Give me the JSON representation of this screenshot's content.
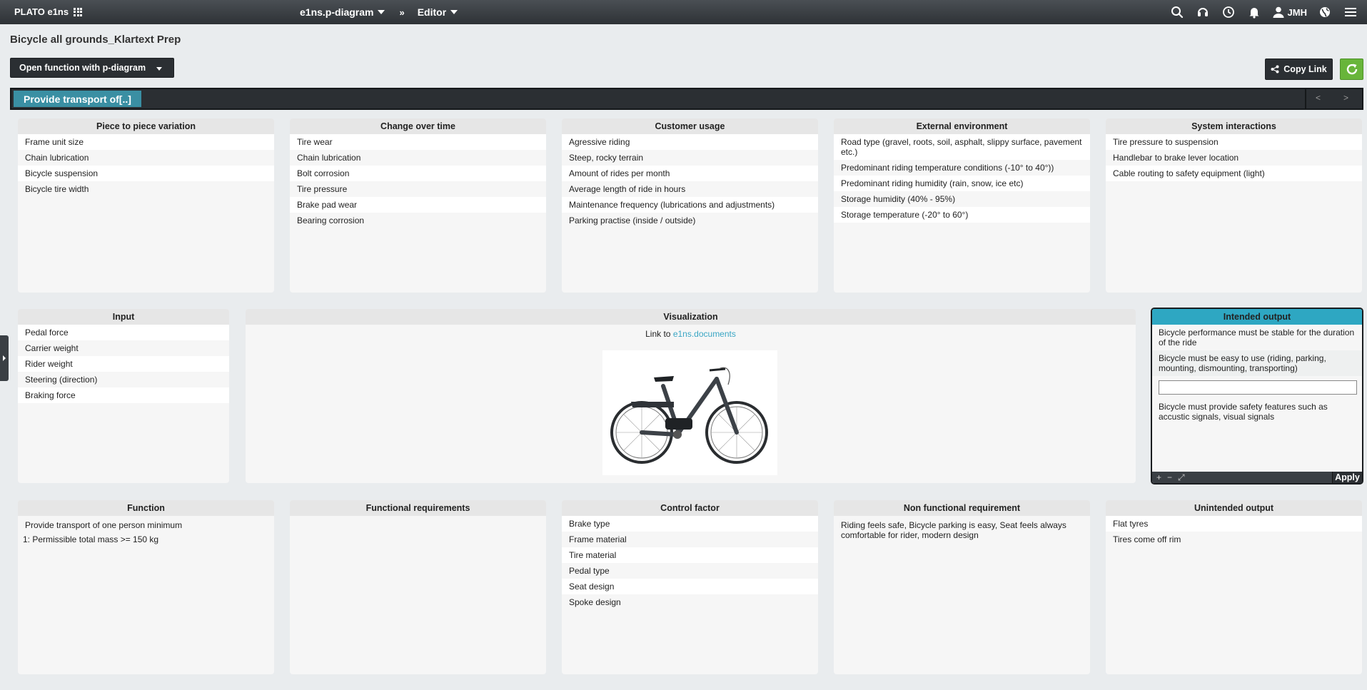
{
  "app": {
    "brand": "PLATO e1ns",
    "nav": [
      {
        "label": "e1ns.p-diagram"
      },
      {
        "label": "Editor"
      }
    ],
    "nav_sep": "»",
    "user": "JMH",
    "icons": [
      "search-icon",
      "headset-icon",
      "clock-icon",
      "bell-icon",
      "user-icon",
      "globe-icon",
      "menu-icon"
    ]
  },
  "page": {
    "title": "Bicycle all grounds_Klartext Prep",
    "function_select": "Open function with p-diagram",
    "copy_link": "Copy Link",
    "function_tab": "Provide transport of[..]",
    "prev": "<",
    "next": ">"
  },
  "colors": {
    "accent": "#3a8fa3",
    "intended_header": "#2ea7c2",
    "refresh": "#68b53a",
    "dark": "#2b2f33"
  },
  "noise": [
    {
      "title": "Piece to piece variation",
      "items": [
        "Frame unit size",
        "Chain lubrication",
        "Bicycle suspension",
        "Bicycle tire width"
      ]
    },
    {
      "title": "Change over time",
      "items": [
        "Tire wear",
        "Chain lubrication",
        "Bolt corrosion",
        "Tire pressure",
        "Brake pad wear",
        "Bearing corrosion"
      ]
    },
    {
      "title": "Customer usage",
      "items": [
        "Agressive riding",
        "Steep, rocky terrain",
        "Amount of rides per month",
        "Average length of ride in hours",
        "Maintenance frequency (lubrications and adjustments)",
        "Parking practise (inside / outside)"
      ]
    },
    {
      "title": "External environment",
      "items": [
        "Road type (gravel, roots, soil, asphalt, slippy surface, pavement etc.)",
        "Predominant riding temperature conditions (-10° to 40°))",
        "Predominant riding humidity (rain, snow, ice etc)",
        "Storage humidity (40% - 95%)",
        "Storage temperature (-20° to 60°)"
      ]
    },
    {
      "title": "System interactions",
      "items": [
        "Tire pressure to suspension",
        "Handlebar to brake lever location",
        "Cable routing to safety equipment (light)"
      ]
    }
  ],
  "input": {
    "title": "Input",
    "items": [
      "Pedal force",
      "Carrier weight",
      "Rider weight",
      "Steering (direction)",
      "Braking force"
    ]
  },
  "visualization": {
    "title": "Visualization",
    "link_prefix": "Link to ",
    "link_text": "e1ns.documents"
  },
  "intended_output": {
    "title": "Intended output",
    "items": [
      "Bicycle performance must be stable for the duration of the ride",
      "Bicycle must be easy to use (riding, parking, mounting, dismounting, transporting)"
    ],
    "input_value": "",
    "last_item": "Bicycle must provide safety features such as accustic signals, visual signals",
    "add": "+",
    "remove": "−",
    "expand": "⤢",
    "apply": "Apply"
  },
  "bottom": [
    {
      "title": "Function",
      "items": [
        "Provide transport of one person minimum",
        "1: Permissible total mass >= 150 kg"
      ]
    },
    {
      "title": "Functional requirements",
      "items": []
    },
    {
      "title": "Control factor",
      "items": [
        "Brake type",
        "Frame material",
        "Tire material",
        "Pedal type",
        "Seat design",
        "Spoke design"
      ]
    },
    {
      "title": "Non functional requirement",
      "items": [
        "Riding feels safe, Bicycle parking is easy, Seat feels always comfortable for rider, modern design"
      ]
    },
    {
      "title": "Unintended output",
      "items": [
        "Flat tyres",
        "Tires come off rim"
      ]
    }
  ]
}
